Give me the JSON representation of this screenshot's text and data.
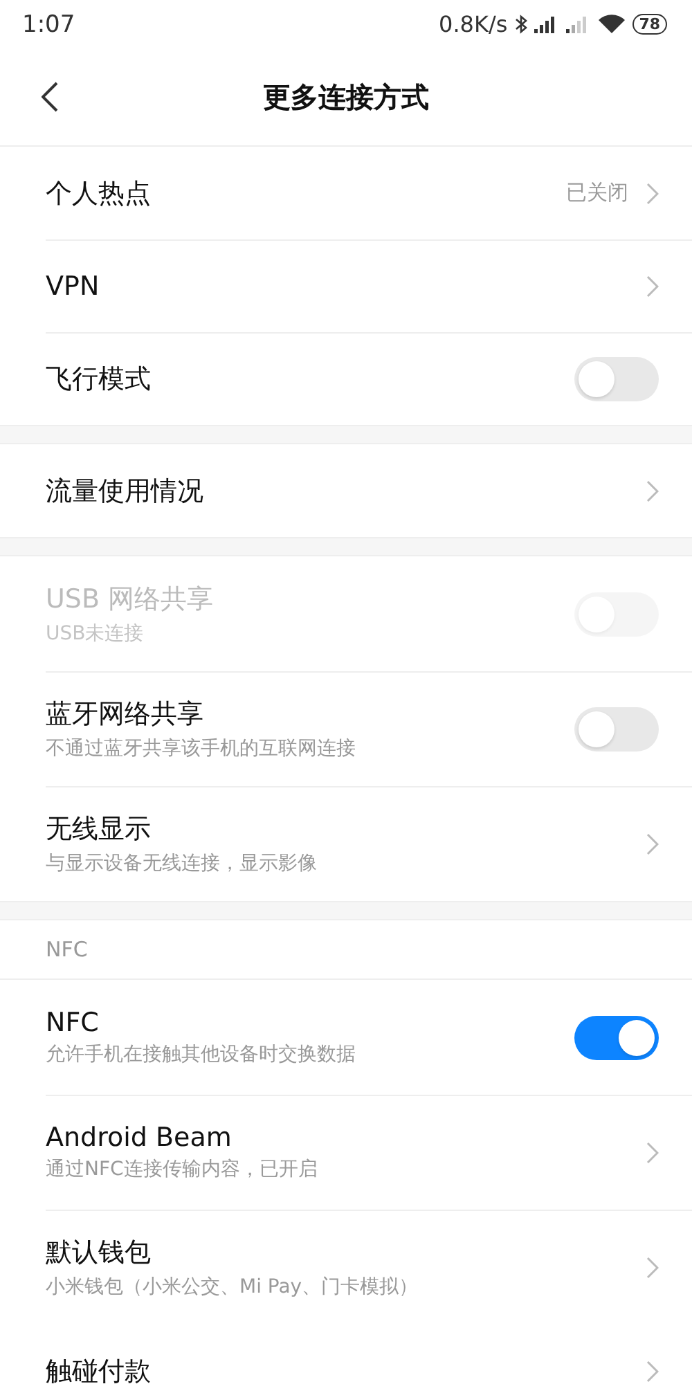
{
  "status_bar": {
    "time": "1:07",
    "speed": "0.8K/s",
    "battery": "78"
  },
  "header": {
    "title": "更多连接方式"
  },
  "sections": [
    {
      "items": [
        {
          "kind": "link",
          "title": "个人热点",
          "value": "已关闭"
        },
        {
          "kind": "link",
          "title": "VPN"
        },
        {
          "kind": "switch",
          "title": "飞行模式",
          "on": false,
          "disabled": false
        }
      ]
    },
    {
      "items": [
        {
          "kind": "link",
          "title": "流量使用情况"
        }
      ]
    },
    {
      "items": [
        {
          "kind": "switch",
          "title": "USB 网络共享",
          "subtitle": "USB未连接",
          "on": false,
          "disabled": true
        },
        {
          "kind": "switch",
          "title": "蓝牙网络共享",
          "subtitle": "不通过蓝牙共享该手机的互联网连接",
          "on": false,
          "disabled": false
        },
        {
          "kind": "link",
          "title": "无线显示",
          "subtitle": "与显示设备无线连接，显示影像"
        }
      ]
    },
    {
      "header": "NFC",
      "items": [
        {
          "kind": "switch",
          "title": "NFC",
          "subtitle": "允许手机在接触其他设备时交换数据",
          "on": true,
          "disabled": false
        },
        {
          "kind": "link",
          "title": "Android Beam",
          "subtitle": "通过NFC连接传输内容，已开启"
        },
        {
          "kind": "link",
          "title": "默认钱包",
          "subtitle": "小米钱包（小米公交、Mi Pay、门卡模拟）"
        },
        {
          "kind": "link",
          "title": "触碰付款"
        }
      ]
    }
  ]
}
